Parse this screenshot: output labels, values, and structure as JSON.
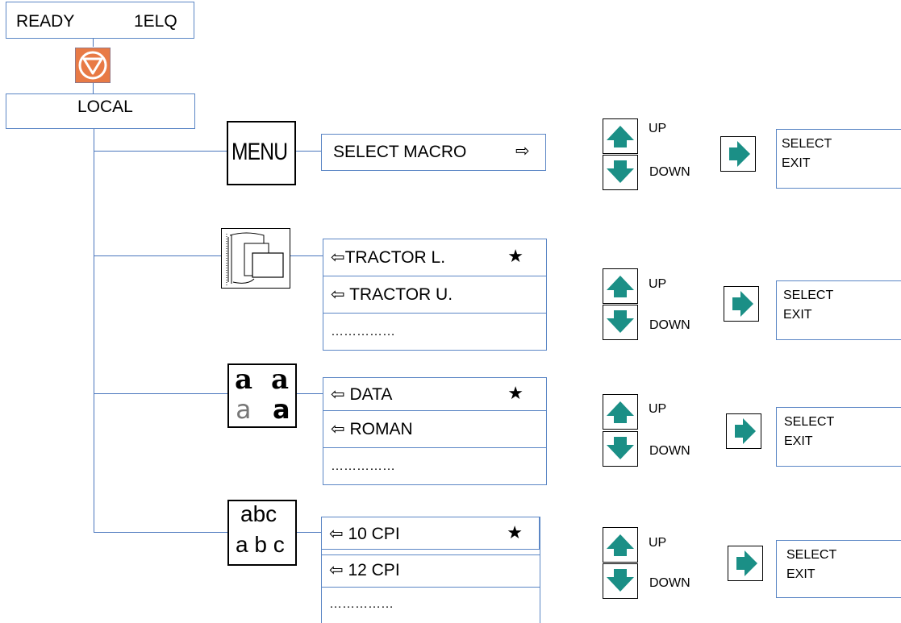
{
  "status": {
    "ready_label": "READY",
    "code": "1ELQ"
  },
  "local_label": "LOCAL",
  "menu_icon_label": "MENU",
  "macro": {
    "label": "SELECT MACRO",
    "arrow": "⇨"
  },
  "paper_options": [
    {
      "arrow": "⇦",
      "label": "TRACTOR L.",
      "star": "★"
    },
    {
      "arrow": "⇦",
      "label": "TRACTOR U.",
      "star": ""
    },
    {
      "arrow": "",
      "label": "……………",
      "star": ""
    }
  ],
  "font_icon": {
    "top_left": "a",
    "top_right": "a",
    "bottom_left": "a",
    "bottom_right": "a"
  },
  "font_options": [
    {
      "arrow": "⇦",
      "label": "DATA",
      "star": "★"
    },
    {
      "arrow": "⇦",
      "label": "ROMAN",
      "star": ""
    },
    {
      "arrow": "",
      "label": "……………",
      "star": ""
    }
  ],
  "pitch_icon": {
    "line1": "abc",
    "line2": "a b c"
  },
  "pitch_options": [
    {
      "arrow": "⇦",
      "label": "10 CPI",
      "star": "★"
    },
    {
      "arrow": "⇦",
      "label": "12 CPI",
      "star": ""
    },
    {
      "arrow": "",
      "label": "……………",
      "star": ""
    }
  ],
  "nav": {
    "up_label": "UP",
    "down_label": "DOWN"
  },
  "select_panel": {
    "select_label": "SELECT",
    "exit_label": "EXIT"
  },
  "colors": {
    "accent_teal": "#1b8f86",
    "stop_orange": "#e87a45",
    "line_blue": "#4a76bd",
    "box_border": "#5b86c5"
  }
}
